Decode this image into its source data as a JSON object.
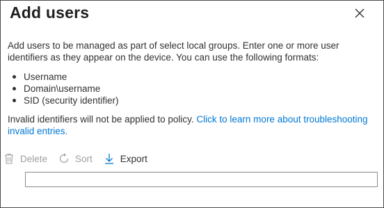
{
  "dialog": {
    "title": "Add users",
    "close_icon": "close-icon"
  },
  "intro_text": "Add users to be managed as part of select local groups. Enter one or more user identifiers as they appear on the device. You can use the following formats:",
  "formats": [
    "Username",
    "Domain\\username",
    "SID (security identifier)"
  ],
  "invalid_note": {
    "text": "Invalid identifiers will not be applied to policy. ",
    "link": "Click to learn more about troubleshooting invalid entries."
  },
  "toolbar": {
    "delete_label": "Delete",
    "sort_label": "Sort",
    "export_label": "Export",
    "delete_icon": "trash-icon",
    "sort_icon": "refresh-icon",
    "export_icon": "download-arrow-icon"
  },
  "user_input": {
    "value": "",
    "placeholder": ""
  },
  "colors": {
    "link": "#0078d4",
    "text": "#323130",
    "disabled": "#a19f9d",
    "border": "#4a4a4a"
  }
}
